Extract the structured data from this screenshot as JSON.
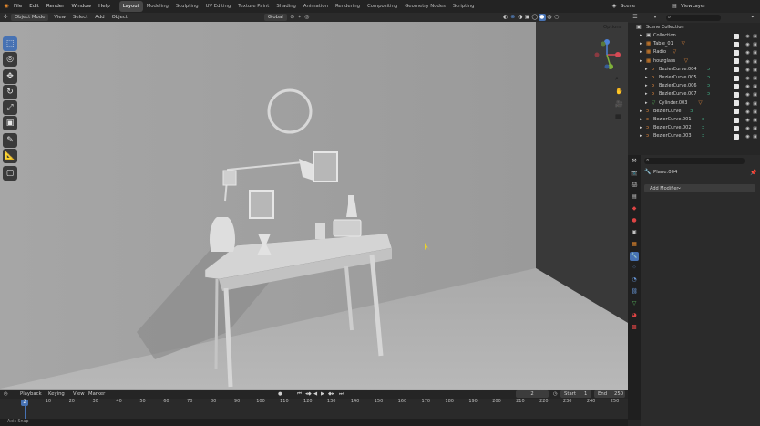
{
  "menu": {
    "file": "File",
    "edit": "Edit",
    "render": "Render",
    "window": "Window",
    "help": "Help"
  },
  "workspaces": [
    "Layout",
    "Modeling",
    "Sculpting",
    "UV Editing",
    "Texture Paint",
    "Shading",
    "Animation",
    "Rendering",
    "Compositing",
    "Geometry Nodes",
    "Scripting"
  ],
  "scene_name": "Scene",
  "view_layer": "ViewLayer",
  "viewport_header": {
    "mode": "Object Mode",
    "view": "View",
    "select": "Select",
    "add": "Add",
    "object": "Object",
    "orientation": "Global",
    "options": "Options"
  },
  "outliner": {
    "root": "Scene Collection",
    "items": [
      {
        "label": "Collection",
        "indent": 1
      },
      {
        "label": "Table_01",
        "indent": 1
      },
      {
        "label": "Radio",
        "indent": 1
      },
      {
        "label": "hourglass",
        "indent": 1
      },
      {
        "label": "BezierCurve.004",
        "indent": 2
      },
      {
        "label": "BezierCurve.005",
        "indent": 2
      },
      {
        "label": "BezierCurve.006",
        "indent": 2
      },
      {
        "label": "BezierCurve.007",
        "indent": 2
      },
      {
        "label": "Cylinder.003",
        "indent": 2
      },
      {
        "label": "BezierCurve",
        "indent": 1
      },
      {
        "label": "BezierCurve.001",
        "indent": 1
      },
      {
        "label": "BezierCurve.002",
        "indent": 1
      },
      {
        "label": "BezierCurve.003",
        "indent": 1
      }
    ]
  },
  "properties": {
    "object_name": "Plane.004",
    "add_modifier": "Add Modifier"
  },
  "timeline": {
    "playback": "Playback",
    "keying": "Keying",
    "view": "View",
    "marker": "Marker",
    "current_frame": "2",
    "start_label": "Start",
    "start": "1",
    "end_label": "End",
    "end": "250",
    "ruler": [
      "0",
      "10",
      "20",
      "30",
      "40",
      "50",
      "60",
      "70",
      "80",
      "90",
      "100",
      "110",
      "120",
      "130",
      "140",
      "150",
      "160",
      "170",
      "180",
      "190",
      "200",
      "210",
      "220",
      "230",
      "240",
      "250"
    ]
  },
  "status": {
    "text": "Axis Snap"
  },
  "colors": {
    "accent": "#4772b3",
    "active_tab": "#474747",
    "curve_orange": "#e4883c",
    "curve_green": "#43b58b"
  }
}
